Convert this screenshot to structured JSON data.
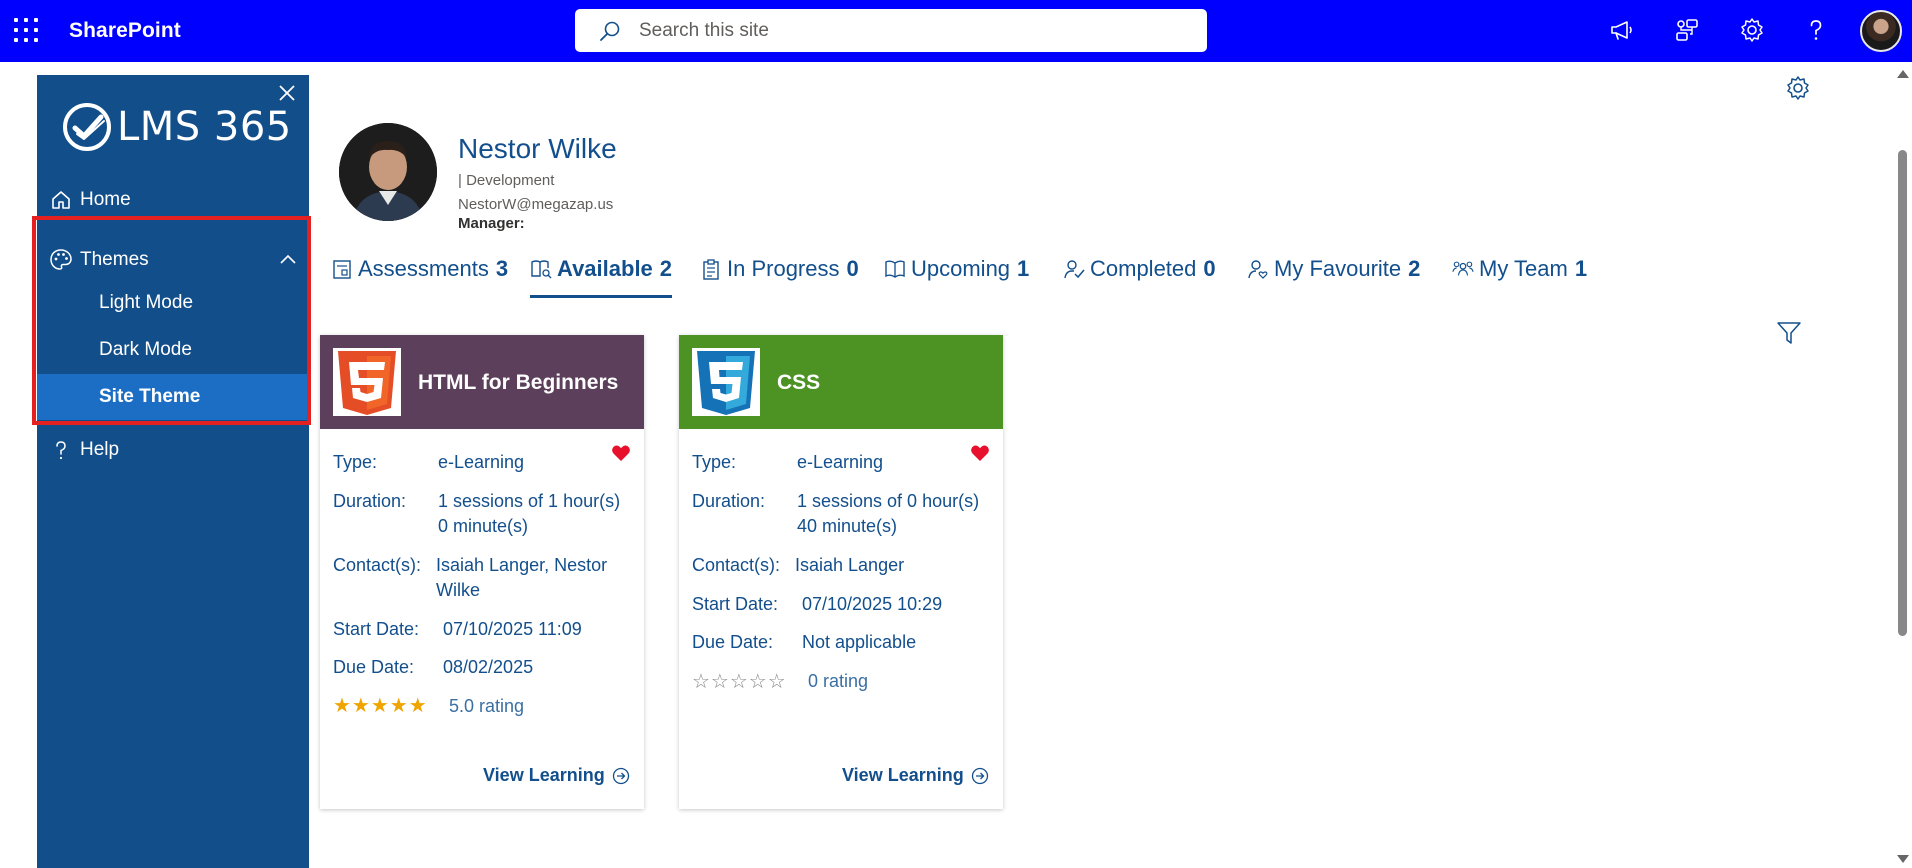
{
  "topbar": {
    "brand": "SharePoint",
    "search_placeholder": "Search this site",
    "bg_color": "#0000ff",
    "icons": [
      "waffle-icon",
      "megaphone-icon",
      "connections-icon",
      "gear-icon",
      "help-icon",
      "user-avatar"
    ]
  },
  "sidebar": {
    "logo_text": "LMS 365",
    "bg_color": "#124e8a",
    "home": "Home",
    "themes": "Themes",
    "theme_items": [
      "Light Mode",
      "Dark Mode",
      "Site Theme"
    ],
    "active_theme": "Site Theme",
    "help": "Help"
  },
  "profile": {
    "name": "Nestor Wilke",
    "department": "| Development",
    "email": "NestorW@megazap.us",
    "manager_label": "Manager:"
  },
  "tabs": [
    {
      "label": "Assessments",
      "count": "3",
      "icon": "assessment-icon"
    },
    {
      "label": "Available",
      "count": "2",
      "icon": "available-icon",
      "active": true
    },
    {
      "label": "In Progress",
      "count": "0",
      "icon": "clipboard-icon"
    },
    {
      "label": "Upcoming",
      "count": "1",
      "icon": "book-icon"
    },
    {
      "label": "Completed",
      "count": "0",
      "icon": "completed-icon"
    },
    {
      "label": "My Favourite",
      "count": "2",
      "icon": "favourite-person-icon"
    },
    {
      "label": "My Team",
      "count": "1",
      "icon": "team-icon"
    }
  ],
  "labels": {
    "type": "Type:",
    "duration": "Duration:",
    "contacts": "Contact(s):",
    "start_date": "Start Date:",
    "due_date": "Due Date:",
    "view_learning": "View Learning"
  },
  "cards": [
    {
      "title": "HTML for Beginners",
      "header_color": "#5c3f5a",
      "logo_icon": "html5-icon",
      "type": "e-Learning",
      "duration_line1": "1 sessions of 1 hour(s)",
      "duration_line2": "0 minute(s)",
      "contacts_line1": "Isaiah Langer, Nestor",
      "contacts_line2": "Wilke",
      "start_date": "07/10/2025 11:09",
      "due_date": "08/02/2025",
      "stars": "★★★★★",
      "rating_value": 5.0,
      "rating_text": "5.0 rating",
      "favourite": true
    },
    {
      "title": "CSS",
      "header_color": "#4c9324",
      "logo_icon": "css3-icon",
      "type": "e-Learning",
      "duration_line1": "1 sessions of 0 hour(s)",
      "duration_line2": "40 minute(s)",
      "contacts_line1": "Isaiah Langer",
      "start_date": "07/10/2025 10:29",
      "due_date": "Not applicable",
      "stars": "☆☆☆☆☆",
      "rating_value": 0,
      "rating_text": "0 rating",
      "favourite": true
    }
  ]
}
